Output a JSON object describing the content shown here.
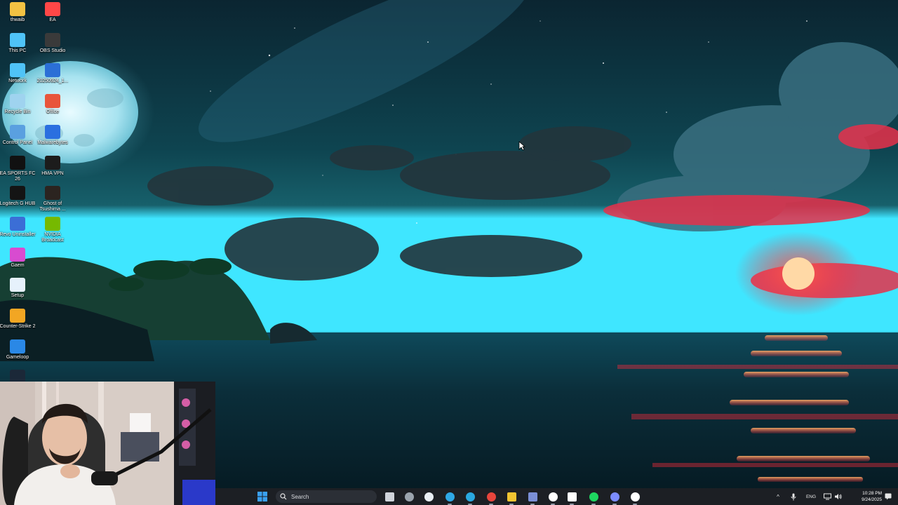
{
  "desktop_icons": [
    {
      "name": "thwaib",
      "icon": "folder-icon",
      "col": 0,
      "row": 0
    },
    {
      "name": "EA",
      "icon": "ea-app-icon",
      "col": 1,
      "row": 0
    },
    {
      "name": "This PC",
      "icon": "computer-icon",
      "col": 0,
      "row": 1
    },
    {
      "name": "OBS Studio",
      "icon": "obs-icon",
      "col": 1,
      "row": 1
    },
    {
      "name": "Network",
      "icon": "network-icon",
      "col": 0,
      "row": 2
    },
    {
      "name": "20250924_1...",
      "icon": "video-file-icon",
      "col": 1,
      "row": 2
    },
    {
      "name": "Recycle Bin",
      "icon": "recycle-bin-icon",
      "col": 0,
      "row": 3
    },
    {
      "name": "Office",
      "icon": "office-icon",
      "col": 1,
      "row": 3
    },
    {
      "name": "Control Panel",
      "icon": "control-panel-icon",
      "col": 0,
      "row": 4
    },
    {
      "name": "Malwarebytes",
      "icon": "malwarebytes-icon",
      "col": 1,
      "row": 4
    },
    {
      "name": "EA SPORTS FC 26",
      "icon": "ea-fc-icon",
      "col": 0,
      "row": 5
    },
    {
      "name": "HMA VPN",
      "icon": "hma-vpn-icon",
      "col": 1,
      "row": 5
    },
    {
      "name": "Logitech G HUB",
      "icon": "logitech-icon",
      "col": 0,
      "row": 6
    },
    {
      "name": "Ghost of Tsushima ...",
      "icon": "ghost-of-tsushima-icon",
      "col": 1,
      "row": 6
    },
    {
      "name": "Revo Uninstaller",
      "icon": "revo-icon",
      "col": 0,
      "row": 7
    },
    {
      "name": "NVIDIA Broadcast",
      "icon": "nvidia-icon",
      "col": 1,
      "row": 7
    },
    {
      "name": "Gaem",
      "icon": "gaem-icon",
      "col": 0,
      "row": 8
    },
    {
      "name": "Setup",
      "icon": "setup-icon",
      "col": 0,
      "row": 9
    },
    {
      "name": "Counter-Strike 2",
      "icon": "counter-strike-icon",
      "col": 0,
      "row": 10
    },
    {
      "name": "Gameloop",
      "icon": "gameloop-icon",
      "col": 0,
      "row": 11
    },
    {
      "name": "",
      "icon": "steam-icon",
      "col": 0,
      "row": 12
    }
  ],
  "taskbar": {
    "search_placeholder": "Search",
    "apps": [
      {
        "name": "task-view-icon",
        "color": "#cfd3da"
      },
      {
        "name": "widgets-icon",
        "color": "#9aa3ad"
      },
      {
        "name": "capcut-icon",
        "color": "#e9eef3"
      },
      {
        "name": "edge-icon",
        "color": "#2fa8e6"
      },
      {
        "name": "telegram-icon",
        "color": "#2aa8e0"
      },
      {
        "name": "chrome-icon",
        "color": "#e8453c"
      },
      {
        "name": "file-explorer-icon",
        "color": "#f2c431"
      },
      {
        "name": "outlook-icon",
        "color": "#7b8fd6"
      },
      {
        "name": "clock-app-icon",
        "color": "#ffffff"
      },
      {
        "name": "notion-icon",
        "color": "#ffffff"
      },
      {
        "name": "spotify-icon",
        "color": "#1ed760"
      },
      {
        "name": "discord-icon",
        "color": "#7c8cff"
      },
      {
        "name": "obs-studio-icon",
        "color": "#ffffff"
      }
    ],
    "tray": {
      "chevron": "^",
      "language": "ENG",
      "time": "10:28 PM",
      "date": "9/24/2025"
    }
  },
  "colors": {
    "taskbar_bg": "#1c1f24",
    "windows_blue": "#3aa0f0",
    "sunset_red": "#ff2a3c",
    "horizon_cyan": "#3fe6ff"
  }
}
